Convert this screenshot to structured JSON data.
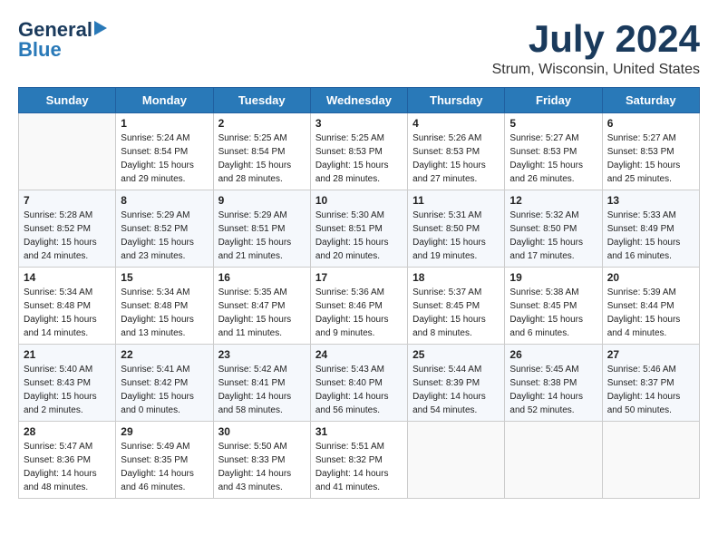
{
  "header": {
    "logo_line1": "General",
    "logo_line2": "Blue",
    "month_title": "July 2024",
    "location": "Strum, Wisconsin, United States"
  },
  "weekdays": [
    "Sunday",
    "Monday",
    "Tuesday",
    "Wednesday",
    "Thursday",
    "Friday",
    "Saturday"
  ],
  "weeks": [
    [
      {
        "day": "",
        "info": ""
      },
      {
        "day": "1",
        "info": "Sunrise: 5:24 AM\nSunset: 8:54 PM\nDaylight: 15 hours\nand 29 minutes."
      },
      {
        "day": "2",
        "info": "Sunrise: 5:25 AM\nSunset: 8:54 PM\nDaylight: 15 hours\nand 28 minutes."
      },
      {
        "day": "3",
        "info": "Sunrise: 5:25 AM\nSunset: 8:53 PM\nDaylight: 15 hours\nand 28 minutes."
      },
      {
        "day": "4",
        "info": "Sunrise: 5:26 AM\nSunset: 8:53 PM\nDaylight: 15 hours\nand 27 minutes."
      },
      {
        "day": "5",
        "info": "Sunrise: 5:27 AM\nSunset: 8:53 PM\nDaylight: 15 hours\nand 26 minutes."
      },
      {
        "day": "6",
        "info": "Sunrise: 5:27 AM\nSunset: 8:53 PM\nDaylight: 15 hours\nand 25 minutes."
      }
    ],
    [
      {
        "day": "7",
        "info": "Sunrise: 5:28 AM\nSunset: 8:52 PM\nDaylight: 15 hours\nand 24 minutes."
      },
      {
        "day": "8",
        "info": "Sunrise: 5:29 AM\nSunset: 8:52 PM\nDaylight: 15 hours\nand 23 minutes."
      },
      {
        "day": "9",
        "info": "Sunrise: 5:29 AM\nSunset: 8:51 PM\nDaylight: 15 hours\nand 21 minutes."
      },
      {
        "day": "10",
        "info": "Sunrise: 5:30 AM\nSunset: 8:51 PM\nDaylight: 15 hours\nand 20 minutes."
      },
      {
        "day": "11",
        "info": "Sunrise: 5:31 AM\nSunset: 8:50 PM\nDaylight: 15 hours\nand 19 minutes."
      },
      {
        "day": "12",
        "info": "Sunrise: 5:32 AM\nSunset: 8:50 PM\nDaylight: 15 hours\nand 17 minutes."
      },
      {
        "day": "13",
        "info": "Sunrise: 5:33 AM\nSunset: 8:49 PM\nDaylight: 15 hours\nand 16 minutes."
      }
    ],
    [
      {
        "day": "14",
        "info": "Sunrise: 5:34 AM\nSunset: 8:48 PM\nDaylight: 15 hours\nand 14 minutes."
      },
      {
        "day": "15",
        "info": "Sunrise: 5:34 AM\nSunset: 8:48 PM\nDaylight: 15 hours\nand 13 minutes."
      },
      {
        "day": "16",
        "info": "Sunrise: 5:35 AM\nSunset: 8:47 PM\nDaylight: 15 hours\nand 11 minutes."
      },
      {
        "day": "17",
        "info": "Sunrise: 5:36 AM\nSunset: 8:46 PM\nDaylight: 15 hours\nand 9 minutes."
      },
      {
        "day": "18",
        "info": "Sunrise: 5:37 AM\nSunset: 8:45 PM\nDaylight: 15 hours\nand 8 minutes."
      },
      {
        "day": "19",
        "info": "Sunrise: 5:38 AM\nSunset: 8:45 PM\nDaylight: 15 hours\nand 6 minutes."
      },
      {
        "day": "20",
        "info": "Sunrise: 5:39 AM\nSunset: 8:44 PM\nDaylight: 15 hours\nand 4 minutes."
      }
    ],
    [
      {
        "day": "21",
        "info": "Sunrise: 5:40 AM\nSunset: 8:43 PM\nDaylight: 15 hours\nand 2 minutes."
      },
      {
        "day": "22",
        "info": "Sunrise: 5:41 AM\nSunset: 8:42 PM\nDaylight: 15 hours\nand 0 minutes."
      },
      {
        "day": "23",
        "info": "Sunrise: 5:42 AM\nSunset: 8:41 PM\nDaylight: 14 hours\nand 58 minutes."
      },
      {
        "day": "24",
        "info": "Sunrise: 5:43 AM\nSunset: 8:40 PM\nDaylight: 14 hours\nand 56 minutes."
      },
      {
        "day": "25",
        "info": "Sunrise: 5:44 AM\nSunset: 8:39 PM\nDaylight: 14 hours\nand 54 minutes."
      },
      {
        "day": "26",
        "info": "Sunrise: 5:45 AM\nSunset: 8:38 PM\nDaylight: 14 hours\nand 52 minutes."
      },
      {
        "day": "27",
        "info": "Sunrise: 5:46 AM\nSunset: 8:37 PM\nDaylight: 14 hours\nand 50 minutes."
      }
    ],
    [
      {
        "day": "28",
        "info": "Sunrise: 5:47 AM\nSunset: 8:36 PM\nDaylight: 14 hours\nand 48 minutes."
      },
      {
        "day": "29",
        "info": "Sunrise: 5:49 AM\nSunset: 8:35 PM\nDaylight: 14 hours\nand 46 minutes."
      },
      {
        "day": "30",
        "info": "Sunrise: 5:50 AM\nSunset: 8:33 PM\nDaylight: 14 hours\nand 43 minutes."
      },
      {
        "day": "31",
        "info": "Sunrise: 5:51 AM\nSunset: 8:32 PM\nDaylight: 14 hours\nand 41 minutes."
      },
      {
        "day": "",
        "info": ""
      },
      {
        "day": "",
        "info": ""
      },
      {
        "day": "",
        "info": ""
      }
    ]
  ]
}
